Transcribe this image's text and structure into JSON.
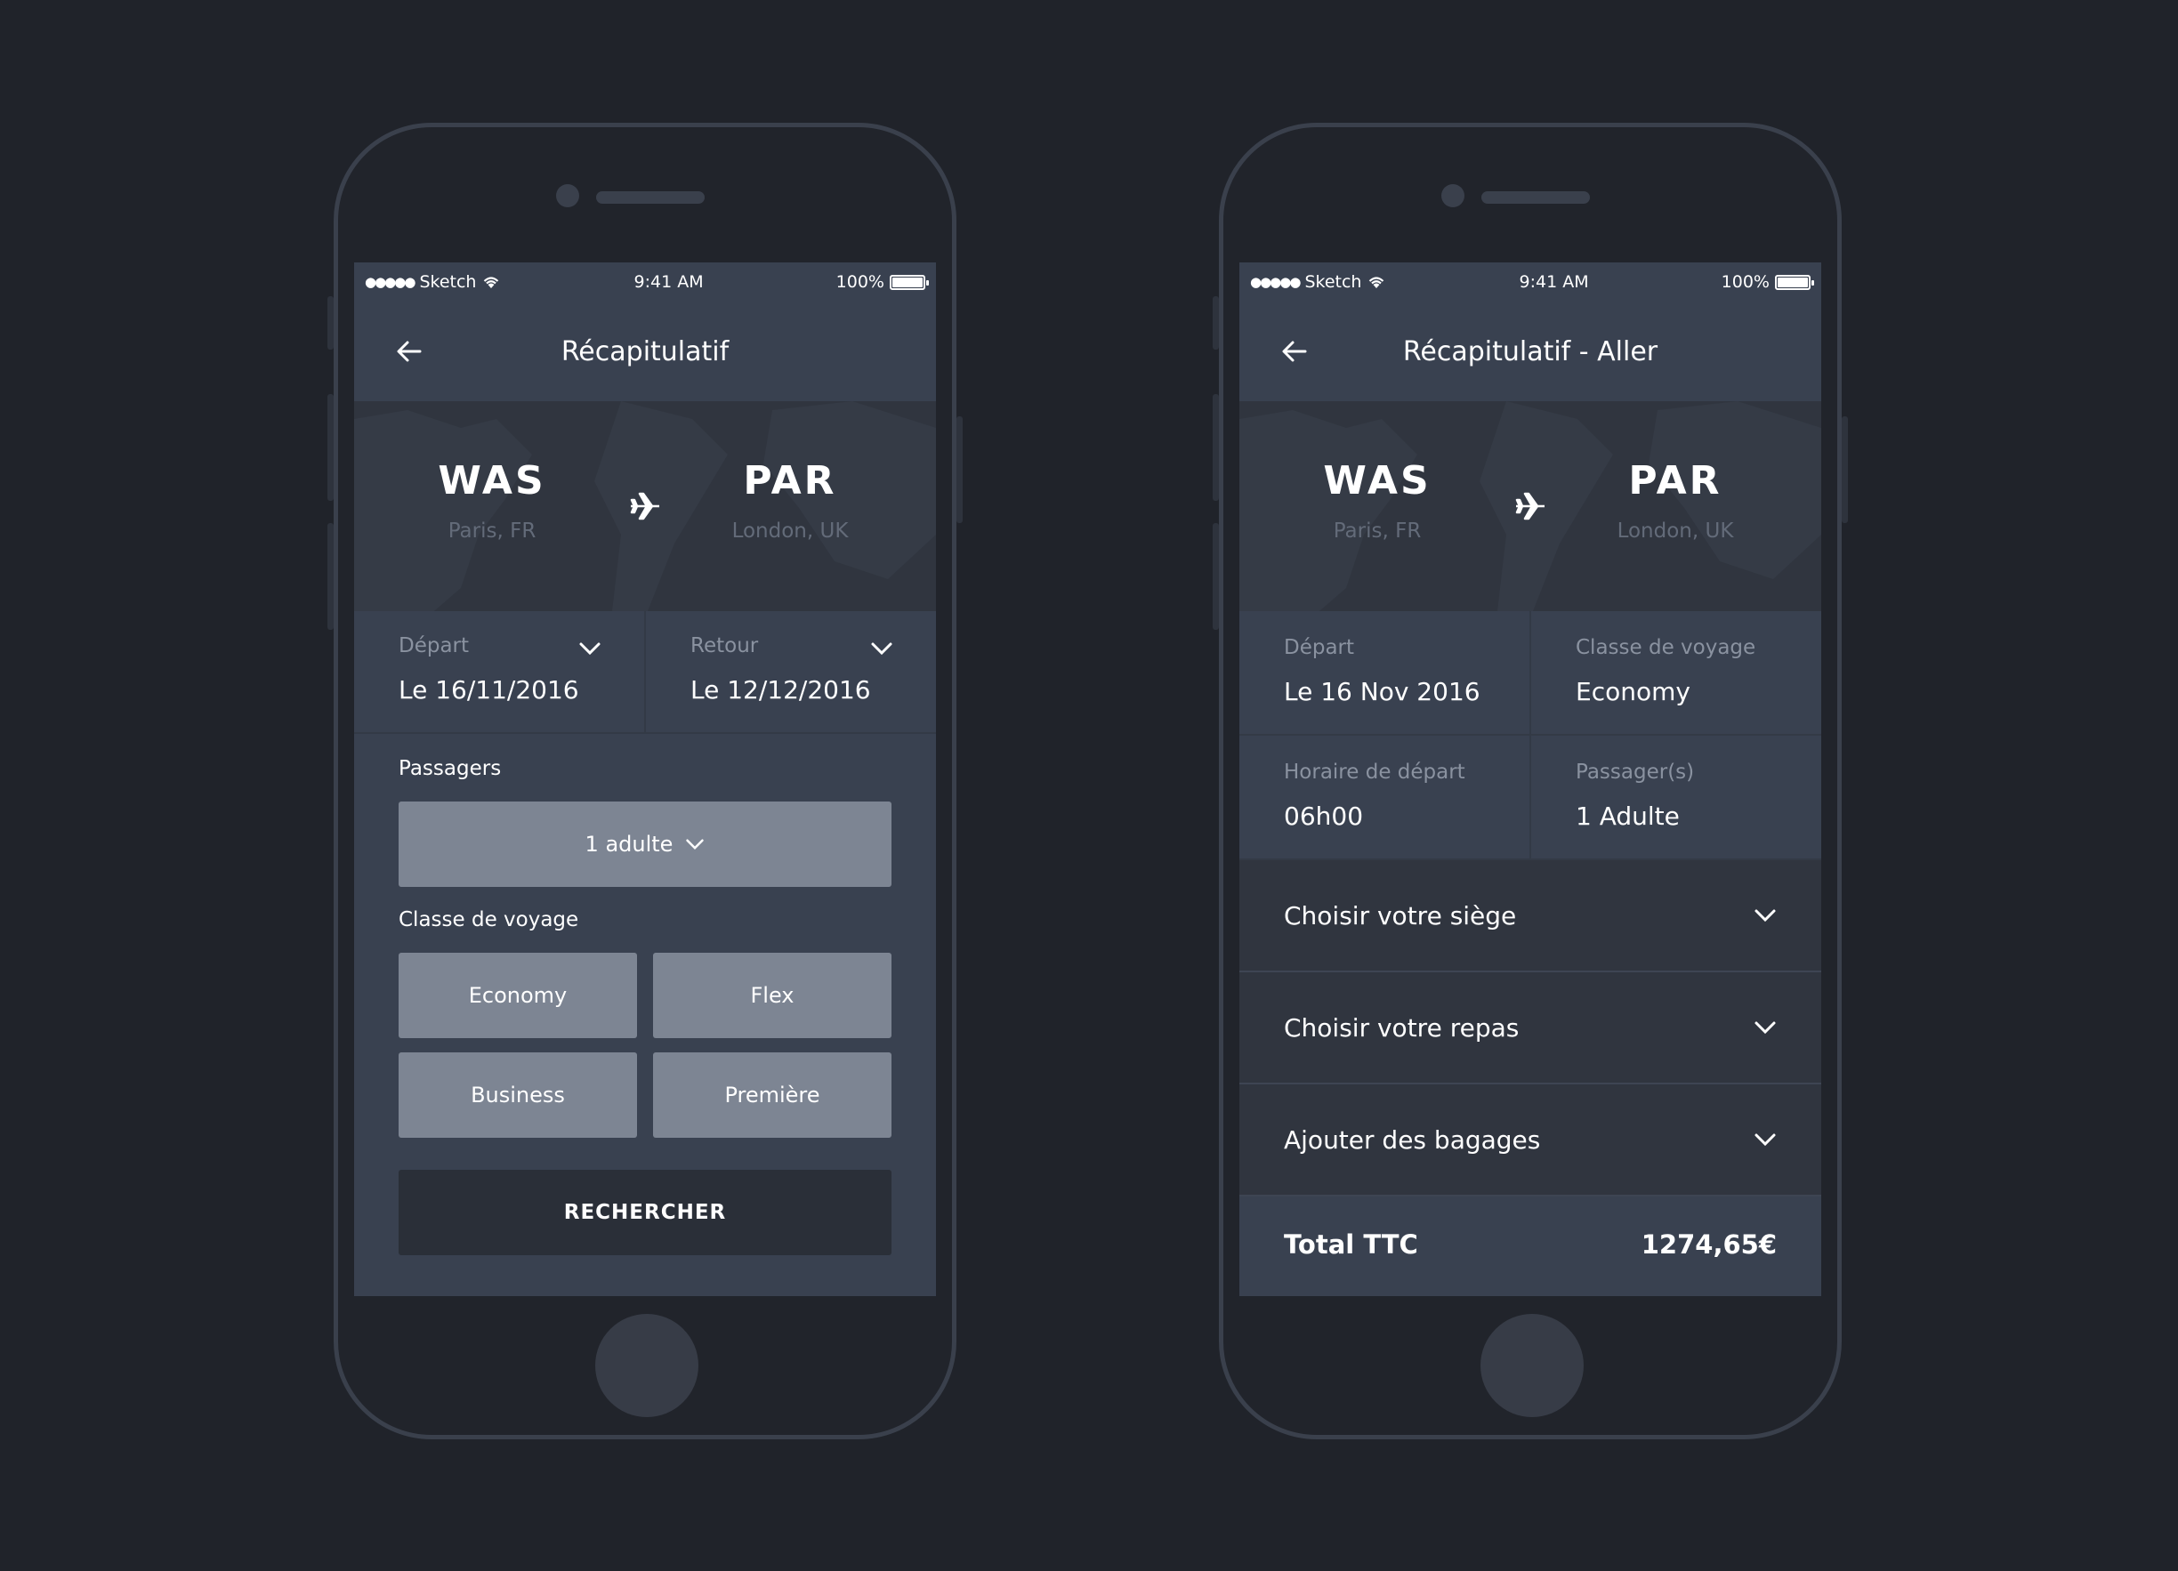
{
  "colors": {
    "background": "#20232a",
    "screen": "#394150",
    "button": "#7d8593",
    "cta": "#2a2f38",
    "muted_text": "#8a92a0"
  },
  "left_phone": {
    "status": {
      "carrier": "Sketch",
      "time": "9:41 AM",
      "battery": "100%"
    },
    "nav_title": "Récapitulatif",
    "route": {
      "from_code": "WAS",
      "from_city": "Paris, FR",
      "to_code": "PAR",
      "to_city": "London, UK"
    },
    "depart": {
      "label": "Départ",
      "value": "Le 16/11/2016"
    },
    "retour": {
      "label": "Retour",
      "value": "Le 12/12/2016"
    },
    "passengers_label": "Passagers",
    "passengers_value": "1 adulte",
    "class_label": "Classe de voyage",
    "class_options": [
      "Economy",
      "Flex",
      "Business",
      "Première"
    ],
    "search_button": "RECHERCHER"
  },
  "right_phone": {
    "status": {
      "carrier": "Sketch",
      "time": "9:41 AM",
      "battery": "100%"
    },
    "nav_title": "Récapitulatif - Aller",
    "route": {
      "from_code": "WAS",
      "from_city": "Paris, FR",
      "to_code": "PAR",
      "to_city": "London, UK"
    },
    "depart": {
      "label": "Départ",
      "value": "Le 16 Nov 2016"
    },
    "class": {
      "label": "Classe de voyage",
      "value": "Economy"
    },
    "departure_time": {
      "label": "Horaire de départ",
      "value": "06h00"
    },
    "passengers": {
      "label": "Passager(s)",
      "value": "1 Adulte"
    },
    "accordions": [
      "Choisir votre siège",
      "Choisir votre repas",
      "Ajouter des bagages"
    ],
    "total_label": "Total TTC",
    "total_value": "1274,65€"
  }
}
